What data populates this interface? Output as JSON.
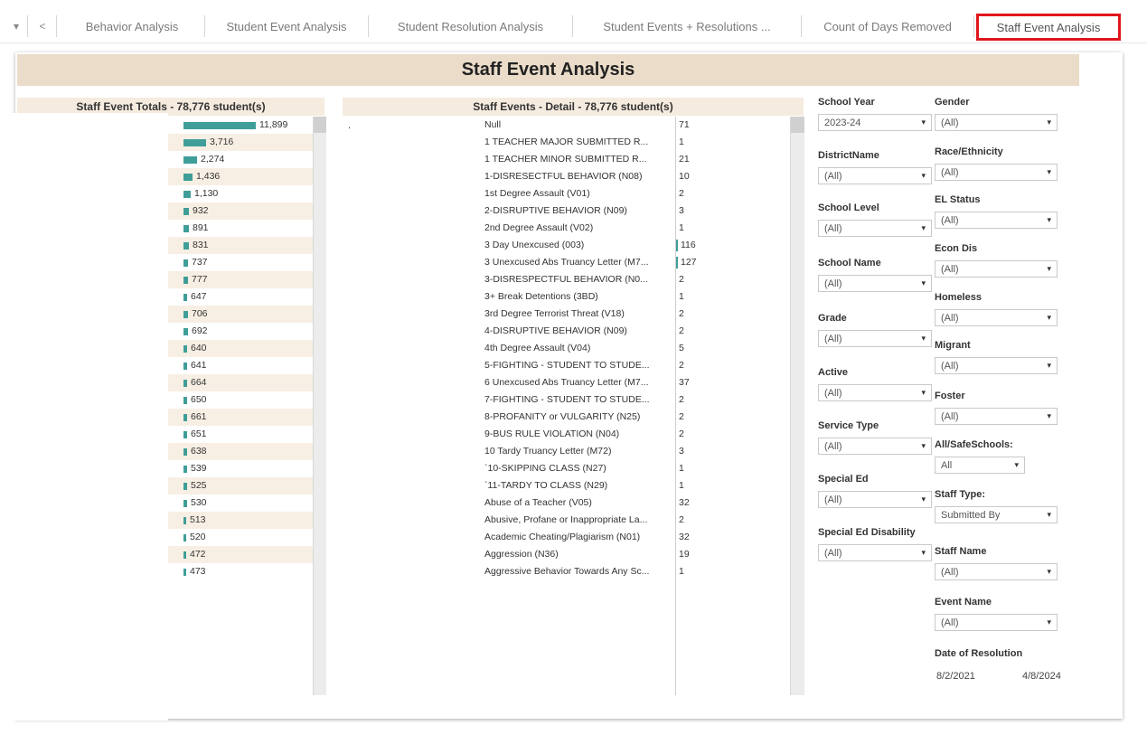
{
  "tabs": [
    {
      "label": "Behavior Analysis"
    },
    {
      "label": "Student Event Analysis"
    },
    {
      "label": "Student Resolution Analysis"
    },
    {
      "label": "Student Events + Resolutions ..."
    },
    {
      "label": "Count of Days Removed"
    },
    {
      "label": "Staff Event Analysis",
      "active": true
    }
  ],
  "tab_controls": {
    "dropdown": "▾",
    "back": "<"
  },
  "dashboard": {
    "title": "Staff Event Analysis",
    "totals_title": "Staff Event Totals  - 78,776 student(s)",
    "detail_title": "Staff Events - Detail  - 78,776 student(s)",
    "bar_color": "#3f9e98",
    "totals": [
      {
        "value": 11899,
        "label": "11,899"
      },
      {
        "value": 3716,
        "label": "3,716"
      },
      {
        "value": 2274,
        "label": "2,274"
      },
      {
        "value": 1436,
        "label": "1,436"
      },
      {
        "value": 1130,
        "label": "1,130"
      },
      {
        "value": 932,
        "label": "932"
      },
      {
        "value": 891,
        "label": "891"
      },
      {
        "value": 831,
        "label": "831"
      },
      {
        "value": 737,
        "label": "737"
      },
      {
        "value": 777,
        "label": "777"
      },
      {
        "value": 647,
        "label": "647"
      },
      {
        "value": 706,
        "label": "706"
      },
      {
        "value": 692,
        "label": "692"
      },
      {
        "value": 640,
        "label": "640"
      },
      {
        "value": 641,
        "label": "641"
      },
      {
        "value": 664,
        "label": "664"
      },
      {
        "value": 650,
        "label": "650"
      },
      {
        "value": 661,
        "label": "661"
      },
      {
        "value": 651,
        "label": "651"
      },
      {
        "value": 638,
        "label": "638"
      },
      {
        "value": 539,
        "label": "539"
      },
      {
        "value": 525,
        "label": "525"
      },
      {
        "value": 530,
        "label": "530"
      },
      {
        "value": 513,
        "label": "513"
      },
      {
        "value": 520,
        "label": "520"
      },
      {
        "value": 472,
        "label": "472"
      },
      {
        "value": 473,
        "label": "473"
      }
    ],
    "detail_marker": ".",
    "detail": [
      {
        "name": "Null",
        "count": "71",
        "bar": false
      },
      {
        "name": "1 TEACHER MAJOR SUBMITTED R...",
        "count": "1",
        "bar": false
      },
      {
        "name": "1 TEACHER MINOR SUBMITTED R...",
        "count": "21",
        "bar": false
      },
      {
        "name": "1-DISRESECTFUL BEHAVIOR (N08)",
        "count": "10",
        "bar": false
      },
      {
        "name": "1st Degree Assault (V01)",
        "count": "2",
        "bar": false
      },
      {
        "name": "2-DISRUPTIVE BEHAVIOR (N09)",
        "count": "3",
        "bar": false
      },
      {
        "name": "2nd Degree Assault (V02)",
        "count": "1",
        "bar": false
      },
      {
        "name": "3 Day Unexcused (003)",
        "count": "116",
        "bar": true
      },
      {
        "name": "3 Unexcused Abs Truancy Letter (M7...",
        "count": "127",
        "bar": true
      },
      {
        "name": "3-DISRESPECTFUL BEHAVIOR (N0...",
        "count": "2",
        "bar": false
      },
      {
        "name": "3+ Break Detentions (3BD)",
        "count": "1",
        "bar": false
      },
      {
        "name": "3rd Degree Terrorist Threat (V18)",
        "count": "2",
        "bar": false
      },
      {
        "name": "4-DISRUPTIVE BEHAVIOR (N09)",
        "count": "2",
        "bar": false
      },
      {
        "name": "4th Degree Assault (V04)",
        "count": "5",
        "bar": false
      },
      {
        "name": "5-FIGHTING - STUDENT TO STUDE...",
        "count": "2",
        "bar": false
      },
      {
        "name": "6 Unexcused Abs Truancy Letter (M7...",
        "count": "37",
        "bar": false
      },
      {
        "name": "7-FIGHTING - STUDENT TO STUDE...",
        "count": "2",
        "bar": false
      },
      {
        "name": "8-PROFANITY or VULGARITY (N25)",
        "count": "2",
        "bar": false
      },
      {
        "name": "9-BUS RULE VIOLATION (N04)",
        "count": "2",
        "bar": false
      },
      {
        "name": "10 Tardy Truancy Letter (M72)",
        "count": "3",
        "bar": false
      },
      {
        "name": "`10-SKIPPING CLASS (N27)",
        "count": "1",
        "bar": false
      },
      {
        "name": "`11-TARDY TO CLASS (N29)",
        "count": "1",
        "bar": false
      },
      {
        "name": "Abuse of a Teacher (V05)",
        "count": "32",
        "bar": false
      },
      {
        "name": "Abusive, Profane or Inappropriate La...",
        "count": "2",
        "bar": false
      },
      {
        "name": "Academic Cheating/Plagiarism (N01)",
        "count": "32",
        "bar": false
      },
      {
        "name": "Aggression (N36)",
        "count": "19",
        "bar": false
      },
      {
        "name": "Aggressive Behavior Towards Any Sc...",
        "count": "1",
        "bar": false
      }
    ]
  },
  "filters_left": [
    {
      "label": "School Year",
      "value": "2023-24"
    },
    {
      "label": "DistrictName",
      "value": "(All)"
    },
    {
      "label": "School Level",
      "value": "(All)"
    },
    {
      "label": "School Name",
      "value": "(All)"
    },
    {
      "label": "Grade",
      "value": "(All)"
    },
    {
      "label": "Active",
      "value": "(All)"
    },
    {
      "label": "Service Type",
      "value": "(All)"
    },
    {
      "label": "Special Ed",
      "value": "(All)"
    },
    {
      "label": "Special Ed Disability",
      "value": "(All)"
    }
  ],
  "filters_right": [
    {
      "label": "Gender",
      "value": "(All)"
    },
    {
      "label": "Race/Ethnicity",
      "value": "(All)"
    },
    {
      "label": "EL Status",
      "value": "(All)"
    },
    {
      "label": "Econ Dis",
      "value": "(All)"
    },
    {
      "label": "Homeless",
      "value": "(All)"
    },
    {
      "label": "Migrant",
      "value": "(All)"
    },
    {
      "label": "Foster",
      "value": "(All)"
    },
    {
      "label": "All/SafeSchools:",
      "value": "All"
    },
    {
      "label": "Staff Type:",
      "value": "Submitted By"
    },
    {
      "label": "Staff Name",
      "value": "(All)"
    },
    {
      "label": "Event Name",
      "value": "(All)"
    }
  ],
  "date_filter": {
    "label": "Date of Resolution",
    "start": "8/2/2021",
    "end": "4/8/2024"
  },
  "dropdown_arrow": "▾"
}
